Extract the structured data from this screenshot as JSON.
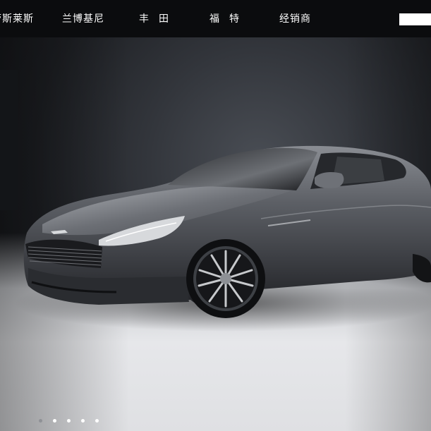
{
  "nav": {
    "items": [
      {
        "label": "劳斯莱斯"
      },
      {
        "label": "兰博基尼"
      },
      {
        "label": "丰田"
      },
      {
        "label": "福特"
      },
      {
        "label": "经销商"
      }
    ],
    "search": {
      "value": "",
      "placeholder": ""
    }
  },
  "carousel": {
    "slide_count": 5,
    "active_index": 0
  },
  "colors": {
    "navbar_bg": "#0b0c0e",
    "nav_text": "#ffffff",
    "car_body": "#5d6066",
    "dot_active": "#8f9196",
    "dot_inactive": "#ffffff"
  }
}
